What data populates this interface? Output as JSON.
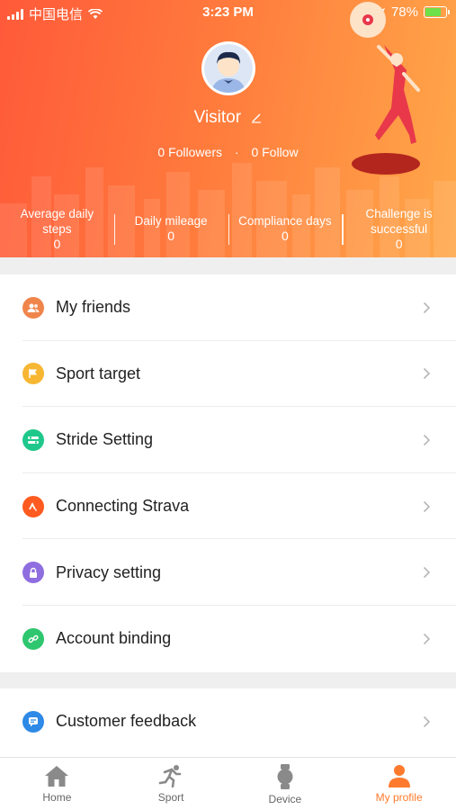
{
  "status_bar": {
    "carrier": "中国电信",
    "time": "3:23 PM",
    "battery": "78%"
  },
  "profile": {
    "username": "Visitor",
    "followers_count": "0",
    "followers_label": "Followers",
    "follow_count": "0",
    "follow_label": "Follow",
    "separator": "·"
  },
  "stats": [
    {
      "label": "Average daily steps",
      "value": "0"
    },
    {
      "label": "Daily mileage",
      "value": "0"
    },
    {
      "label": "Compliance days",
      "value": "0"
    },
    {
      "label": "Challenge is successful",
      "value": "0"
    }
  ],
  "menu": [
    {
      "label": "My friends",
      "icon": "friends-icon",
      "color": "#f0854c"
    },
    {
      "label": "Sport target",
      "icon": "flag-icon",
      "color": "#f7b733"
    },
    {
      "label": "Stride Setting",
      "icon": "stride-icon",
      "color": "#1fc88a"
    },
    {
      "label": "Connecting Strava",
      "icon": "strava-icon",
      "color": "#ff5a1f"
    },
    {
      "label": "Privacy setting",
      "icon": "lock-icon",
      "color": "#8f6ee0"
    },
    {
      "label": "Account binding",
      "icon": "link-icon",
      "color": "#2ec66f"
    }
  ],
  "menu2": [
    {
      "label": "Customer feedback",
      "icon": "feedback-icon",
      "color": "#2e8ae6"
    }
  ],
  "tabs": [
    {
      "label": "Home",
      "icon": "home-icon",
      "active": false
    },
    {
      "label": "Sport",
      "icon": "runner-icon",
      "active": false
    },
    {
      "label": "Device",
      "icon": "watch-icon",
      "active": false
    },
    {
      "label": "My profile",
      "icon": "person-icon",
      "active": true
    }
  ],
  "colors": {
    "accent": "#ff7a2c",
    "header_start": "#ff5a3a",
    "header_end": "#ffa84a"
  }
}
